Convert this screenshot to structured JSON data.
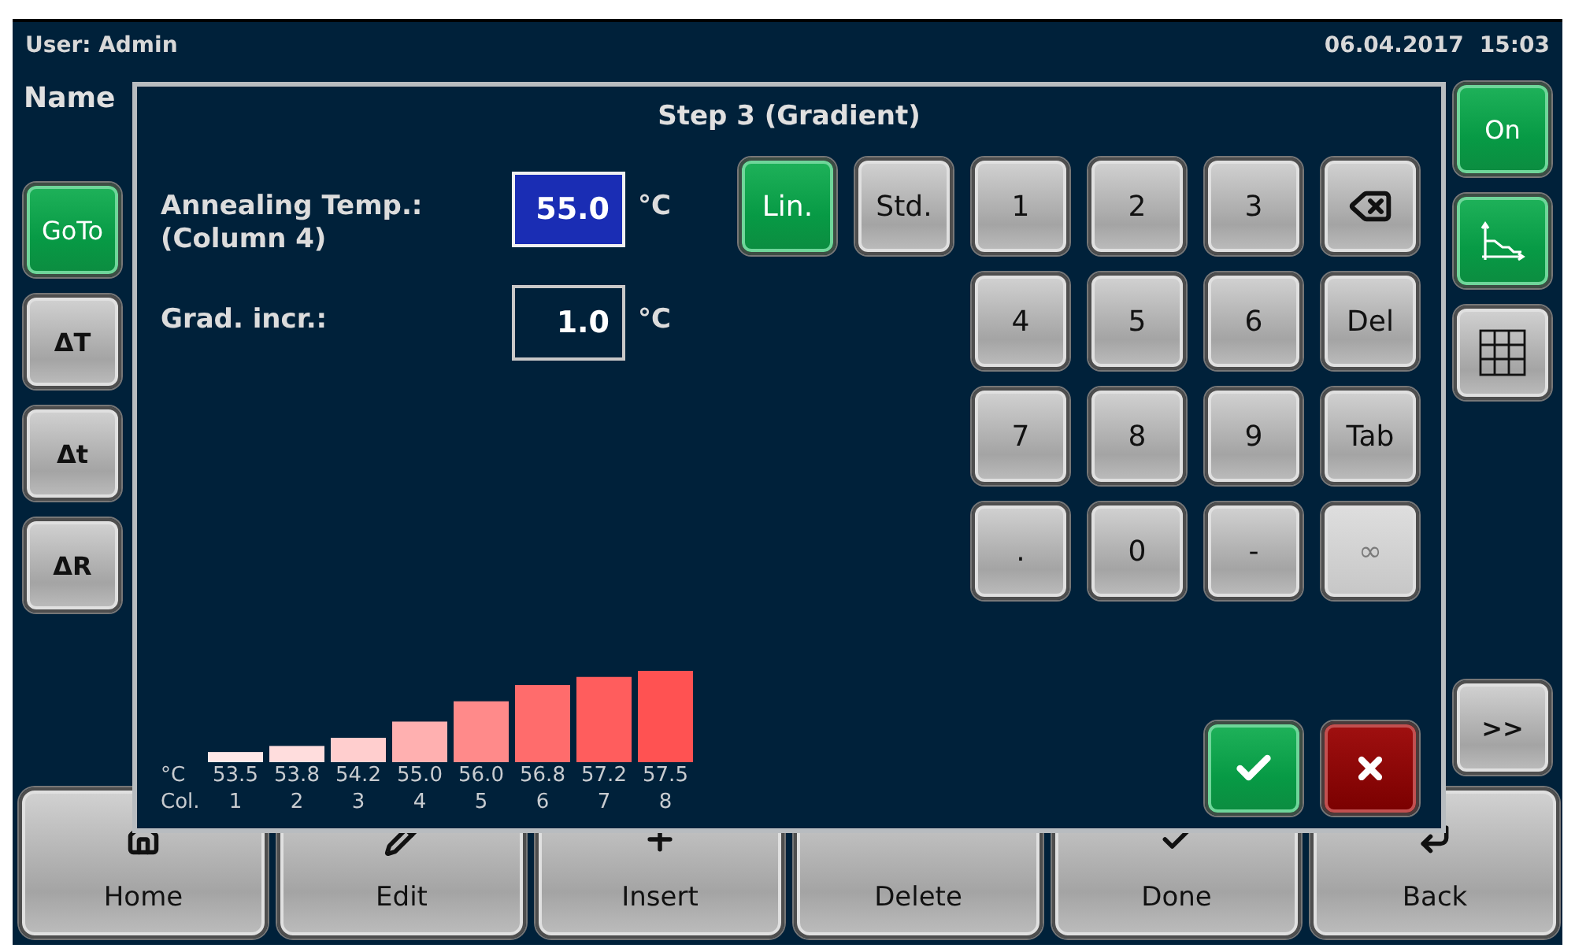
{
  "top_bar": {
    "user": "User: Admin",
    "date": "06.04.2017",
    "time": "15:03"
  },
  "program_name_label": "Name",
  "left_buttons": [
    {
      "label": "GoTo",
      "on": true
    },
    {
      "label": "ΔT",
      "on": false
    },
    {
      "label": "Δt",
      "on": false
    },
    {
      "label": "ΔR",
      "on": false
    }
  ],
  "right_buttons": [
    {
      "kind": "text",
      "label": "On",
      "on": true
    },
    {
      "kind": "graph",
      "on": true
    },
    {
      "kind": "table",
      "on": false
    },
    {
      "kind": "text",
      "label": ">>",
      "on": false
    }
  ],
  "bottom_buttons": [
    {
      "kind": "home",
      "label": "Home"
    },
    {
      "kind": "edit",
      "label": "Edit"
    },
    {
      "kind": "insert",
      "label": "Insert"
    },
    {
      "kind": "delete",
      "label": "Delete"
    },
    {
      "kind": "done",
      "label": "Done"
    },
    {
      "kind": "back",
      "label": "Back"
    }
  ],
  "dialog": {
    "title": "Step 3 (Gradient)",
    "fields": [
      {
        "label": "Annealing Temp.:",
        "sublabel": "(Column 4)",
        "value": "55.0",
        "unit": "°C",
        "selected": true
      },
      {
        "label": "Grad. incr.:",
        "value": "1.0",
        "unit": "°C",
        "selected": false
      }
    ],
    "mode_buttons": [
      {
        "label": "Lin.",
        "selected": true
      },
      {
        "label": "Std.",
        "selected": false
      }
    ],
    "keypad": [
      {
        "kind": "key",
        "label": "1",
        "disabled": false
      },
      {
        "kind": "key",
        "label": "2",
        "disabled": false
      },
      {
        "kind": "key",
        "label": "3",
        "disabled": false
      },
      {
        "kind": "backspace",
        "disabled": false
      },
      {
        "kind": "key",
        "label": "4",
        "disabled": false
      },
      {
        "kind": "key",
        "label": "5",
        "disabled": false
      },
      {
        "kind": "key",
        "label": "6",
        "disabled": false
      },
      {
        "kind": "key",
        "label": "Del",
        "disabled": false
      },
      {
        "kind": "key",
        "label": "7",
        "disabled": false
      },
      {
        "kind": "key",
        "label": "8",
        "disabled": false
      },
      {
        "kind": "key",
        "label": "9",
        "disabled": false
      },
      {
        "kind": "key",
        "label": "Tab",
        "disabled": false
      },
      {
        "kind": "key",
        "label": ".",
        "disabled": false
      },
      {
        "kind": "key",
        "label": "0",
        "disabled": false
      },
      {
        "kind": "key",
        "label": "-",
        "disabled": false
      },
      {
        "kind": "key",
        "label": "∞",
        "disabled": true
      }
    ],
    "gradient": {
      "value_row_label": "°C",
      "column_row_label": "Col.",
      "chart_data": {
        "type": "bar",
        "categories": [
          "1",
          "2",
          "3",
          "4",
          "5",
          "6",
          "7",
          "8"
        ],
        "values": [
          53.5,
          53.8,
          54.2,
          55.0,
          56.0,
          56.8,
          57.2,
          57.5
        ],
        "ylim": [
          53.0,
          57.5
        ],
        "value_labels": [
          "53.5",
          "53.8",
          "54.2",
          "55.0",
          "56.0",
          "56.8",
          "57.2",
          "57.5"
        ]
      }
    }
  }
}
